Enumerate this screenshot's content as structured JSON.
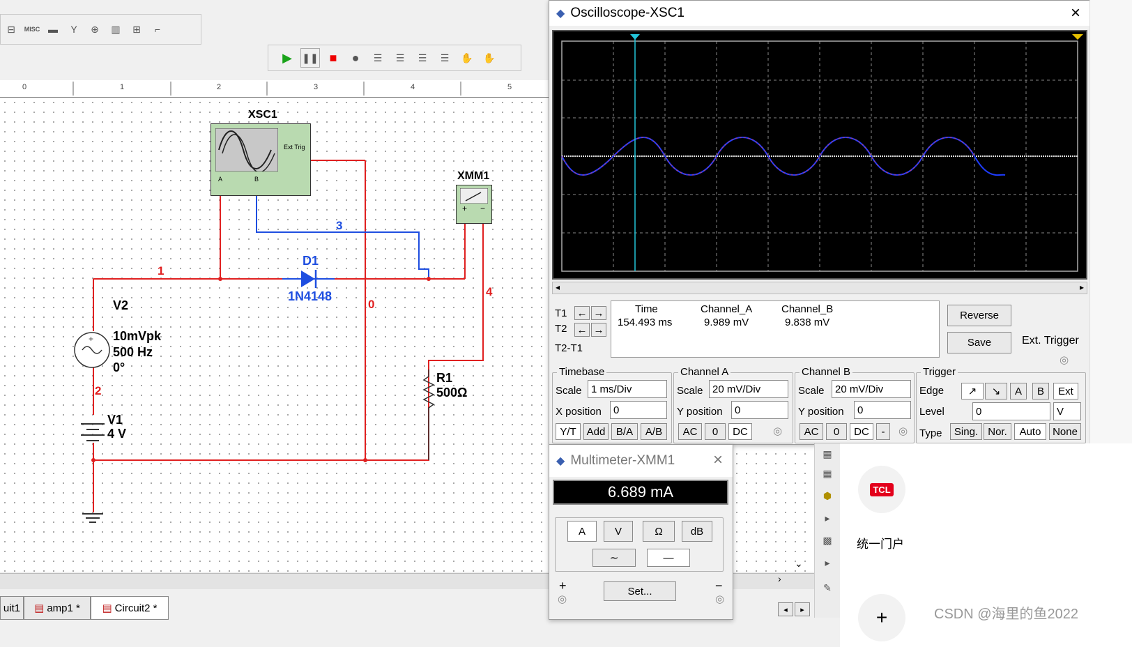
{
  "toolbar": {
    "misc_label": "MISC"
  },
  "ruler": {
    "marks": [
      "0",
      "1",
      "2",
      "3",
      "4",
      "5"
    ]
  },
  "schematic": {
    "xsc1": "XSC1",
    "ext_trig": "Ext Trig",
    "ch_a": "A",
    "ch_b": "B",
    "xmm1": "XMM1",
    "v2": "V2",
    "v2_amp": "10mVpk",
    "v2_freq": "500 Hz",
    "v2_phase": "0°",
    "v1": "V1",
    "v1_val": "4 V",
    "d1": "D1",
    "d1_part": "1N4148",
    "r1": "R1",
    "r1_val": "500Ω",
    "net1": "1",
    "net2": "2",
    "net3": "3",
    "net4": "4",
    "net0": "0"
  },
  "tabs": [
    {
      "label": "uit1"
    },
    {
      "label": "amp1 *"
    },
    {
      "label": "Circuit2 *"
    }
  ],
  "osc": {
    "title": "Oscilloscope-XSC1",
    "t1": "T1",
    "t2": "T2",
    "t2t1": "T2-T1",
    "col_time": "Time",
    "col_cha": "Channel_A",
    "col_chb": "Channel_B",
    "time_val": "154.493 ms",
    "cha_val": "9.989 mV",
    "chb_val": "9.838 mV",
    "reverse": "Reverse",
    "save": "Save",
    "ext_trigger": "Ext. Trigger",
    "timebase": {
      "title": "Timebase",
      "scale_label": "Scale",
      "scale": "1 ms/Div",
      "xpos_label": "X position",
      "xpos": "0",
      "yt": "Y/T",
      "add": "Add",
      "ba": "B/A",
      "ab": "A/B"
    },
    "channel_a": {
      "title": "Channel A",
      "scale_label": "Scale",
      "scale": "20 mV/Div",
      "ypos_label": "Y position",
      "ypos": "0",
      "ac": "AC",
      "zero": "0",
      "dc": "DC"
    },
    "channel_b": {
      "title": "Channel B",
      "scale_label": "Scale",
      "scale": "20 mV/Div",
      "ypos_label": "Y position",
      "ypos": "0",
      "ac": "AC",
      "zero": "0",
      "dc": "DC",
      "minus": "-"
    },
    "trigger": {
      "title": "Trigger",
      "edge_label": "Edge",
      "a": "A",
      "b": "B",
      "ext": "Ext",
      "level_label": "Level",
      "level": "0",
      "unit": "V",
      "type_label": "Type",
      "sing": "Sing.",
      "nor": "Nor.",
      "auto": "Auto",
      "none": "None"
    },
    "screen_bg": "#000000",
    "trace_color": "#1e3cff",
    "cursor_color": "#22c4d8"
  },
  "mm": {
    "title": "Multimeter-XMM1",
    "reading": "6.689 mA",
    "a": "A",
    "v": "V",
    "ohm": "Ω",
    "db": "dB",
    "set": "Set...",
    "plus": "+",
    "minus": "−"
  },
  "right_panel": {
    "tcl": "TCL",
    "portal": "统一门户",
    "plus": "+"
  },
  "watermark": "CSDN @海里的鱼2022"
}
